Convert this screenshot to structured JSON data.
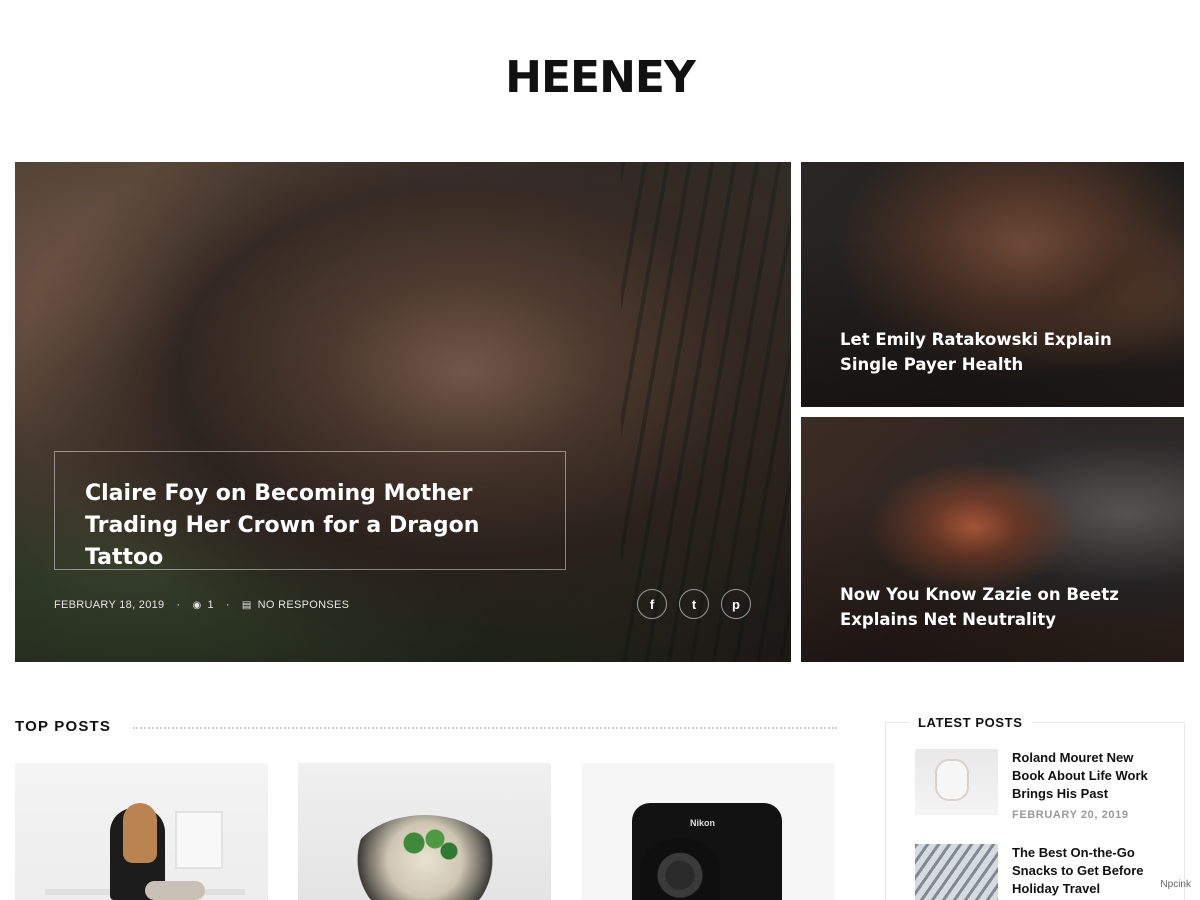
{
  "site": {
    "title": "HEENEY"
  },
  "hero": {
    "main": {
      "title": "Claire Foy on Becoming Mother Trading Her Crown for a Dragon Tattoo",
      "date": "FEBRUARY 18, 2019",
      "views": "1",
      "responses": "NO RESPONSES",
      "social": [
        {
          "icon": "facebook-icon",
          "glyph": "f"
        },
        {
          "icon": "twitter-icon",
          "glyph": "t"
        },
        {
          "icon": "pinterest-icon",
          "glyph": "p"
        }
      ]
    },
    "side": [
      {
        "title": "Let Emily Ratakowski Explain Single Payer Health"
      },
      {
        "title": "Now You Know Zazie on Beetz Explains Net Neutrality"
      }
    ]
  },
  "top_posts": {
    "heading": "TOP POSTS"
  },
  "latest_posts": {
    "heading": "LATEST POSTS",
    "items": [
      {
        "title": "Roland Mouret New Book About Life Work Brings His Past",
        "date": "FEBRUARY 20, 2019"
      },
      {
        "title": "The Best On-the-Go Snacks to Get Before Holiday Travel"
      }
    ]
  },
  "camera_brand": "Nikon",
  "watermark": "Npcink"
}
